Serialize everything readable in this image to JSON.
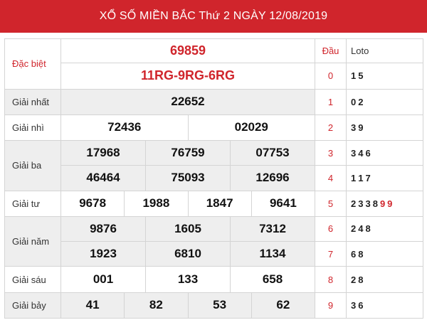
{
  "header": {
    "title": "XỔ SỐ MIỀN BẮC Thứ 2 NGÀY 12/08/2019"
  },
  "columns": {
    "dau": "Đầu",
    "loto": "Loto"
  },
  "prizes": {
    "special": {
      "label": "Đặc biệt",
      "value": "69859",
      "codes": "11RG-9RG-6RG"
    },
    "first": {
      "label": "Giải nhất",
      "values": [
        "22652"
      ]
    },
    "second": {
      "label": "Giải nhì",
      "values": [
        "72436",
        "02029"
      ]
    },
    "third": {
      "label": "Giải ba",
      "values": [
        "17968",
        "76759",
        "07753",
        "46464",
        "75093",
        "12696"
      ]
    },
    "fourth": {
      "label": "Giải tư",
      "values": [
        "9678",
        "1988",
        "1847",
        "9641"
      ]
    },
    "fifth": {
      "label": "Giải năm",
      "values": [
        "9876",
        "1605",
        "7312",
        "1923",
        "6810",
        "1134"
      ]
    },
    "sixth": {
      "label": "Giải sáu",
      "values": [
        "001",
        "133",
        "658"
      ]
    },
    "seventh": {
      "label": "Giải bảy",
      "values": [
        "41",
        "82",
        "53",
        "62"
      ]
    }
  },
  "loto_table": [
    {
      "dau": "0",
      "loto": [
        "1",
        "5"
      ]
    },
    {
      "dau": "1",
      "loto": [
        "0",
        "2"
      ]
    },
    {
      "dau": "2",
      "loto": [
        "3",
        "9"
      ]
    },
    {
      "dau": "3",
      "loto": [
        "3",
        "4",
        "6"
      ]
    },
    {
      "dau": "4",
      "loto": [
        "1",
        "1",
        "7"
      ]
    },
    {
      "dau": "5",
      "loto": [
        "2",
        "3",
        "3",
        "8",
        "9",
        "9"
      ],
      "highlight": [
        4,
        5
      ]
    },
    {
      "dau": "6",
      "loto": [
        "2",
        "4",
        "8"
      ]
    },
    {
      "dau": "7",
      "loto": [
        "6",
        "8"
      ]
    },
    {
      "dau": "8",
      "loto": [
        "2",
        "8"
      ]
    },
    {
      "dau": "9",
      "loto": [
        "3",
        "6"
      ]
    }
  ],
  "colors": {
    "header_bg": "#d0252c",
    "accent_red": "#d0252c",
    "row_alt": "#eeeeee"
  }
}
